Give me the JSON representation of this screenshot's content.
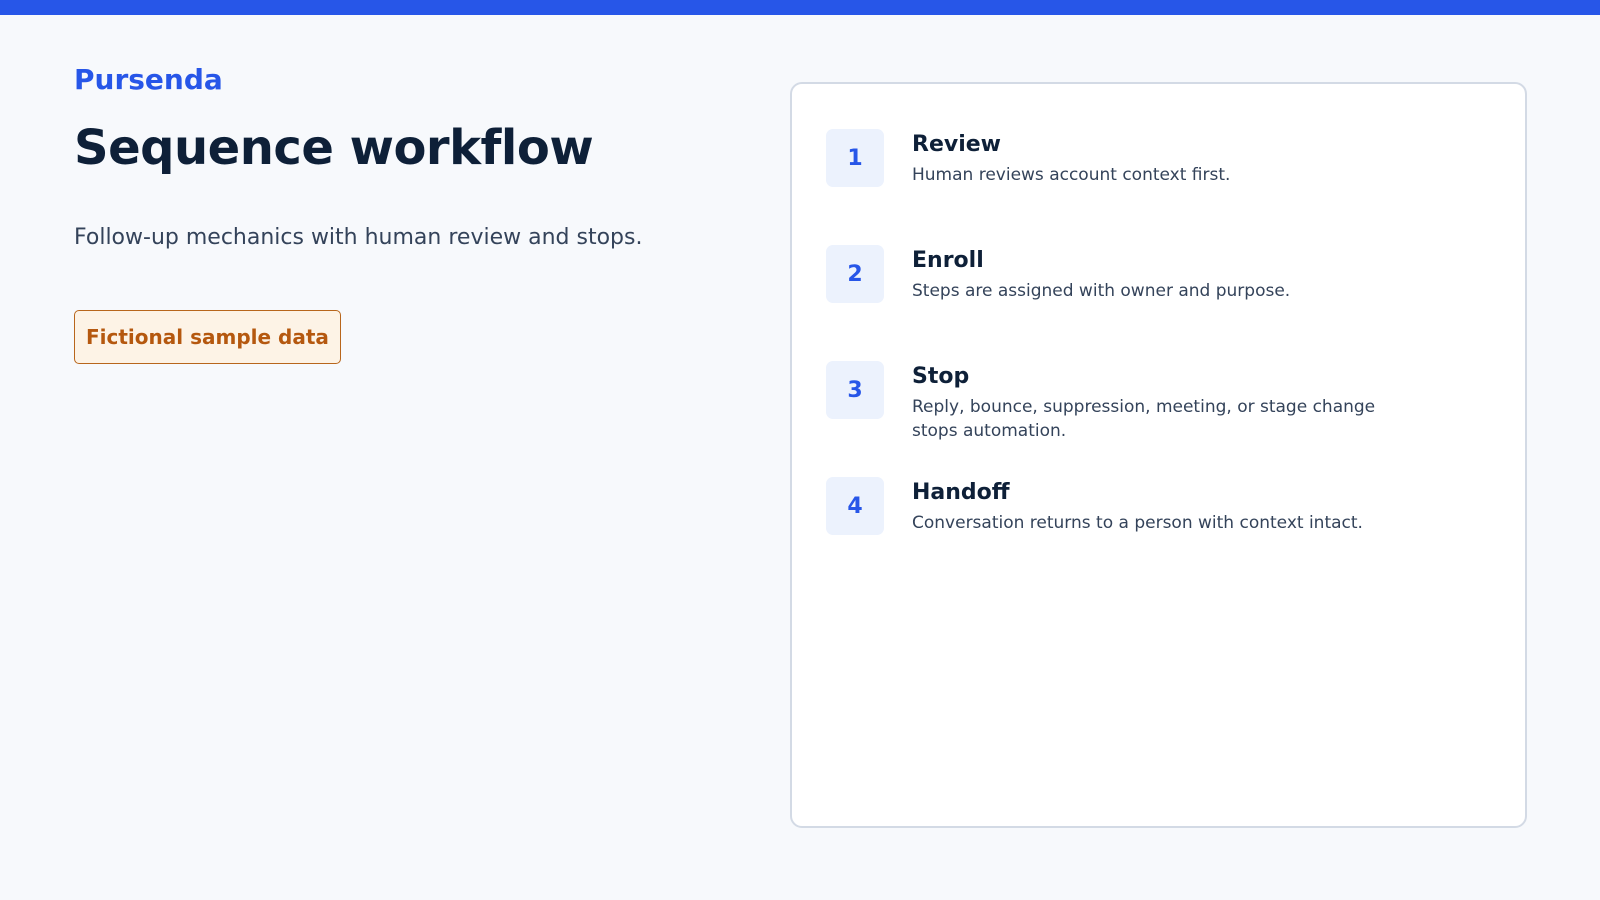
{
  "brand": "Pursenda",
  "title": "Sequence workflow",
  "subtitle": "Follow-up mechanics with human review and stops.",
  "badge": "Fictional sample data",
  "colors": {
    "accent": "#2756e8",
    "badge_text": "#b5580f",
    "badge_border": "#b8661c"
  },
  "steps": [
    {
      "number": "1",
      "title": "Review",
      "description": "Human reviews account context first."
    },
    {
      "number": "2",
      "title": "Enroll",
      "description": "Steps are assigned with owner and purpose."
    },
    {
      "number": "3",
      "title": "Stop",
      "description": "Reply, bounce, suppression, meeting, or stage change stops automation."
    },
    {
      "number": "4",
      "title": "Handoff",
      "description": "Conversation returns to a person with context intact."
    }
  ]
}
